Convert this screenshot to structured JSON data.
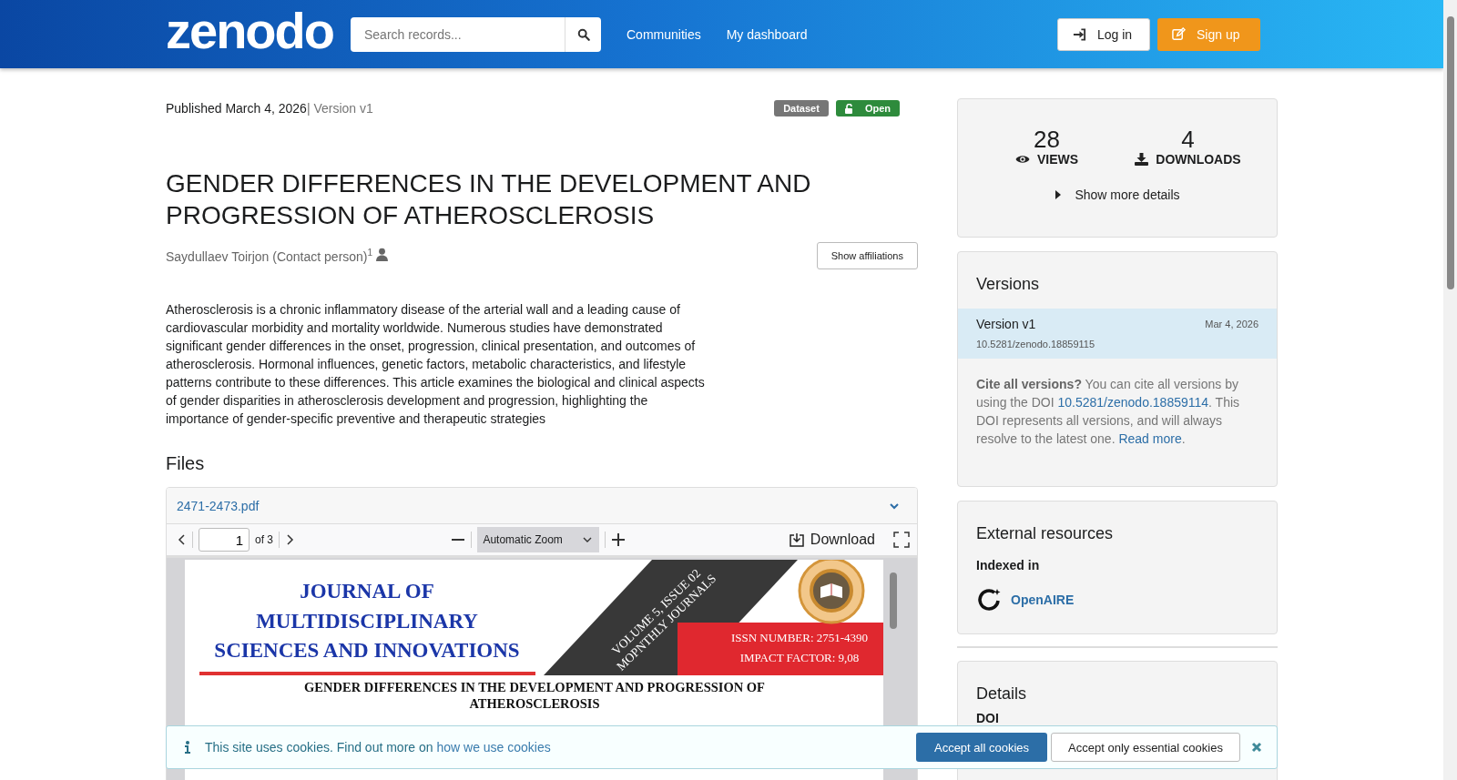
{
  "header": {
    "logo": "zenodo",
    "search": {
      "placeholder": "Search records..."
    },
    "nav": [
      {
        "label": "Communities"
      },
      {
        "label": "My dashboard"
      }
    ],
    "buttons": [
      {
        "label": "Log in",
        "kind": "login"
      },
      {
        "label": "Sign up",
        "kind": "signup"
      }
    ]
  },
  "record": {
    "published": "Published March 4, 2026",
    "version": "| Version v1",
    "badges": [
      {
        "label": "Dataset",
        "kind": "type"
      },
      {
        "label": "Open",
        "kind": "access"
      }
    ],
    "title": "GENDER DIFFERENCES IN THE DEVELOPMENT AND PROGRESSION OF ATHEROSCLEROSIS",
    "creator": {
      "name": "Saydullaev Toirjon (Contact person)",
      "mark": "1"
    },
    "affiliations_button": "Show affiliations",
    "abstract": "Atherosclerosis is a chronic inflammatory disease of the arterial wall and a leading cause of cardiovascular morbidity and mortality worldwide. Numerous studies have demonstrated significant gender differences in the onset, progression, clinical presentation, and outcomes of atherosclerosis. Hormonal influences, genetic factors, metabolic characteristics, and lifestyle patterns contribute to these differences. This article examines the biological and clinical aspects of gender disparities in atherosclerosis development and progression, highlighting the importance of gender-specific preventive and therapeutic strategies",
    "files_heading": "Files",
    "file": {
      "name": "2471-2473.pdf",
      "expanded": true,
      "viewer": {
        "page": "1",
        "page_count": "of 3",
        "zoom": "Automatic Zoom",
        "download": "Download",
        "document": {
          "journal_lines": [
            "JOURNAL OF",
            "MULTIDISCIPLINARY",
            "SCIENCES AND INNOVATIONS"
          ],
          "band_lines": [
            "VOLUME 5, ISSUE 02",
            "MOPNTHLY JOURNALS"
          ],
          "info_lines": [
            "ISSN NUMBER: 2751-4390",
            "IMPACT FACTOR: 9,08"
          ],
          "article_title_lines": [
            "GENDER DIFFERENCES IN THE DEVELOPMENT AND PROGRESSION OF",
            "ATHEROSCLEROSIS"
          ]
        }
      }
    }
  },
  "sidebar": {
    "stats": [
      {
        "value": "28",
        "label": "VIEWS",
        "kind": "views"
      },
      {
        "value": "4",
        "label": "DOWNLOADS",
        "kind": "downloads"
      }
    ],
    "more_details": {
      "label": "Show more details",
      "expanded": false
    },
    "versions": {
      "heading": "Versions",
      "items": [
        {
          "title": "Version v1",
          "date": "Mar 4, 2026",
          "doi": "10.5281/zenodo.18859115",
          "selected": true
        }
      ],
      "cite": {
        "bold": "Cite all versions?",
        "text": " You can cite all versions by using the DOI ",
        "doi": "10.5281/zenodo.18859114",
        "text2": ". This DOI represents all versions, and will always resolve to the latest one. ",
        "link": "Read more",
        "end": "."
      }
    },
    "external": {
      "heading": "External resources",
      "label": "Indexed in",
      "items": [
        {
          "name": "OpenAIRE"
        }
      ]
    },
    "details": {
      "heading": "Details",
      "label": "DOI"
    }
  },
  "cookie_banner": {
    "text": "This site uses cookies. Find out more on ",
    "link": "how we use cookies",
    "buttons": [
      {
        "label": "Accept all cookies",
        "kind": "primary"
      },
      {
        "label": "Accept only essential cookies",
        "kind": "secondary"
      }
    ]
  }
}
